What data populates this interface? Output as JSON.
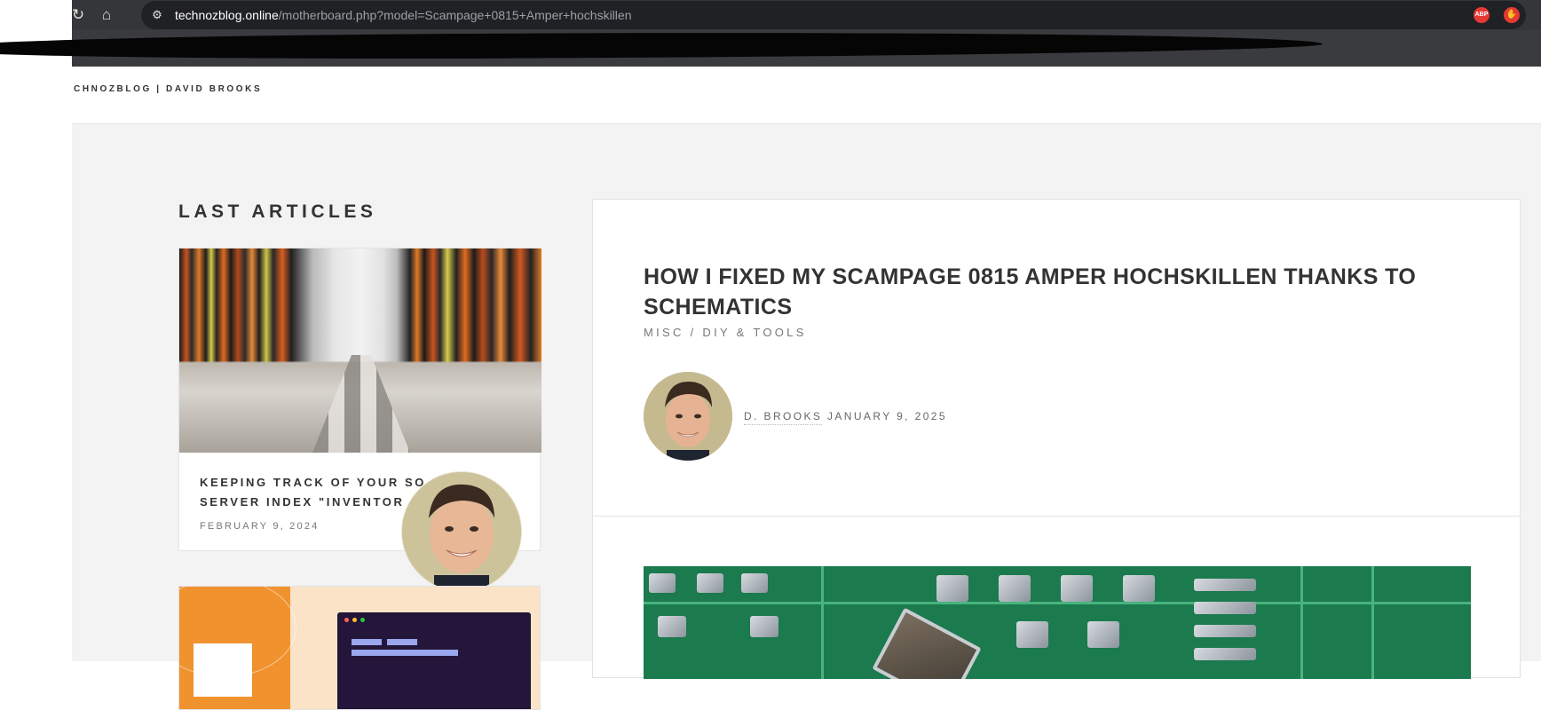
{
  "browser": {
    "reload_icon": "reload-icon",
    "home_icon": "home-icon",
    "url_host": "technozblog.online",
    "url_path": "/motherboard.php?model=Scampage+0815+Amper+hochskillen",
    "extensions": [
      {
        "name": "adblock-plus-icon",
        "label": "ABP"
      },
      {
        "name": "hand-stop-icon",
        "label": "✋"
      }
    ]
  },
  "site": {
    "title": "CHNOZBLOG | DAVID BROOKS"
  },
  "sidebar": {
    "heading": "LAST ARTICLES",
    "articles": [
      {
        "title": "KEEPING TRACK OF YOUR SO… SERVER INDEX \"INVENTOR…",
        "title_line1": "KEEPING TRACK OF YOUR SO",
        "title_line2": "SERVER INDEX \"INVENTOR",
        "date": "FEBRUARY 9, 2024"
      }
    ]
  },
  "article": {
    "title": "HOW I FIXED MY SCAMPAGE 0815 AMPER HOCHSKILLEN THANKS TO SCHEMATICS",
    "category": "MISC / DIY & TOOLS",
    "author": "D. BROOKS",
    "date": "JANUARY 9, 2025"
  },
  "colors": {
    "chrome": "#35363a",
    "omnibox": "#202124",
    "content_bg": "#f3f3f3",
    "text_dark": "#333333",
    "text_muted": "#777777"
  }
}
